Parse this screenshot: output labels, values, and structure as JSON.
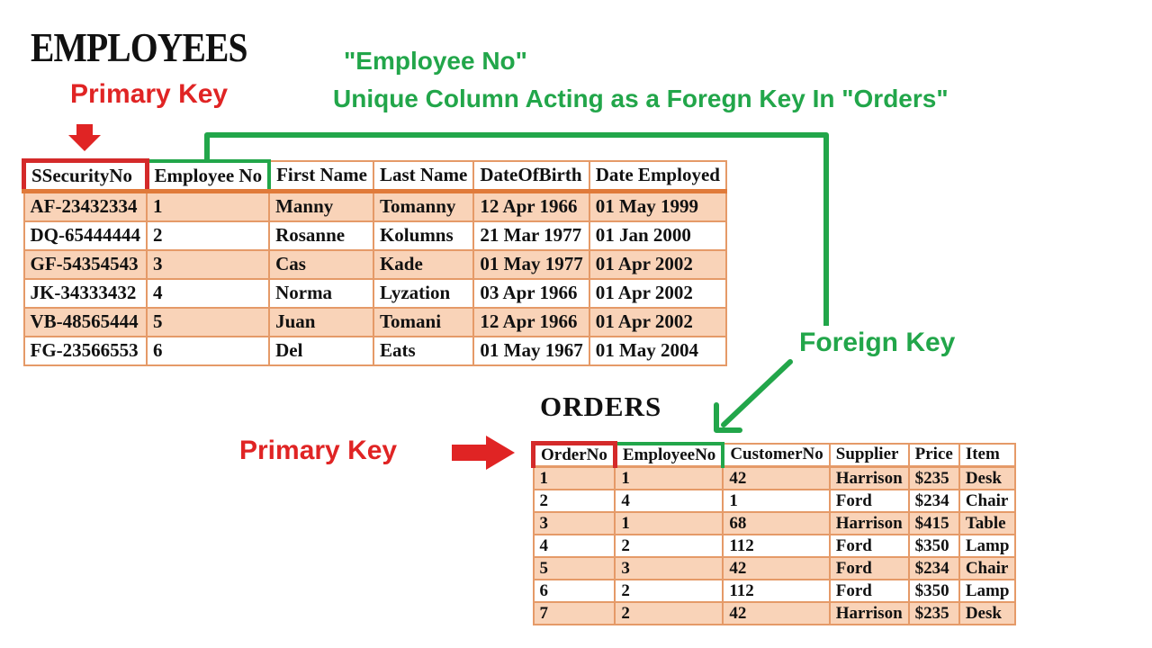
{
  "employees": {
    "title": "EMPLOYEES",
    "primary_key_label": "Primary Key",
    "columns": [
      "SSecurityNo",
      "Employee No",
      "First Name",
      "Last Name",
      "DateOfBirth",
      "Date Employed"
    ],
    "rows": [
      [
        "AF-23432334",
        "1",
        "Manny",
        "Tomanny",
        "12 Apr 1966",
        "01 May 1999"
      ],
      [
        "DQ-65444444",
        "2",
        "Rosanne",
        "Kolumns",
        "21 Mar 1977",
        "01 Jan 2000"
      ],
      [
        "GF-54354543",
        "3",
        "Cas",
        "Kade",
        "01 May 1977",
        "01 Apr 2002"
      ],
      [
        "JK-34333432",
        "4",
        "Norma",
        "Lyzation",
        "03 Apr 1966",
        "01 Apr 2002"
      ],
      [
        "VB-48565444",
        "5",
        "Juan",
        "Tomani",
        "12 Apr 1966",
        "01 Apr 2002"
      ],
      [
        "FG-23566553",
        "6",
        "Del",
        "Eats",
        "01 May 1967",
        "01 May 2004"
      ]
    ]
  },
  "annotation": {
    "field_name": "\"Employee No\"",
    "description": "Unique Column Acting as a Foregn Key In \"Orders\"",
    "foreign_key_label": "Foreign Key"
  },
  "orders": {
    "title": "ORDERS",
    "primary_key_label": "Primary Key",
    "columns": [
      "OrderNo",
      "EmployeeNo",
      "CustomerNo",
      "Supplier",
      "Price",
      "Item"
    ],
    "rows": [
      [
        "1",
        "1",
        "42",
        "Harrison",
        "$235",
        "Desk"
      ],
      [
        "2",
        "4",
        "1",
        "Ford",
        "$234",
        "Chair"
      ],
      [
        "3",
        "1",
        "68",
        "Harrison",
        "$415",
        "Table"
      ],
      [
        "4",
        "2",
        "112",
        "Ford",
        "$350",
        "Lamp"
      ],
      [
        "5",
        "3",
        "42",
        "Ford",
        "$234",
        "Chair"
      ],
      [
        "6",
        "2",
        "112",
        "Ford",
        "$350",
        "Lamp"
      ],
      [
        "7",
        "2",
        "42",
        "Harrison",
        "$235",
        "Desk"
      ]
    ]
  },
  "colors": {
    "primary_key": "#d42a2a",
    "foreign_key": "#22a64a",
    "row_shade": "#f9d3b8",
    "border": "#e59a68"
  }
}
